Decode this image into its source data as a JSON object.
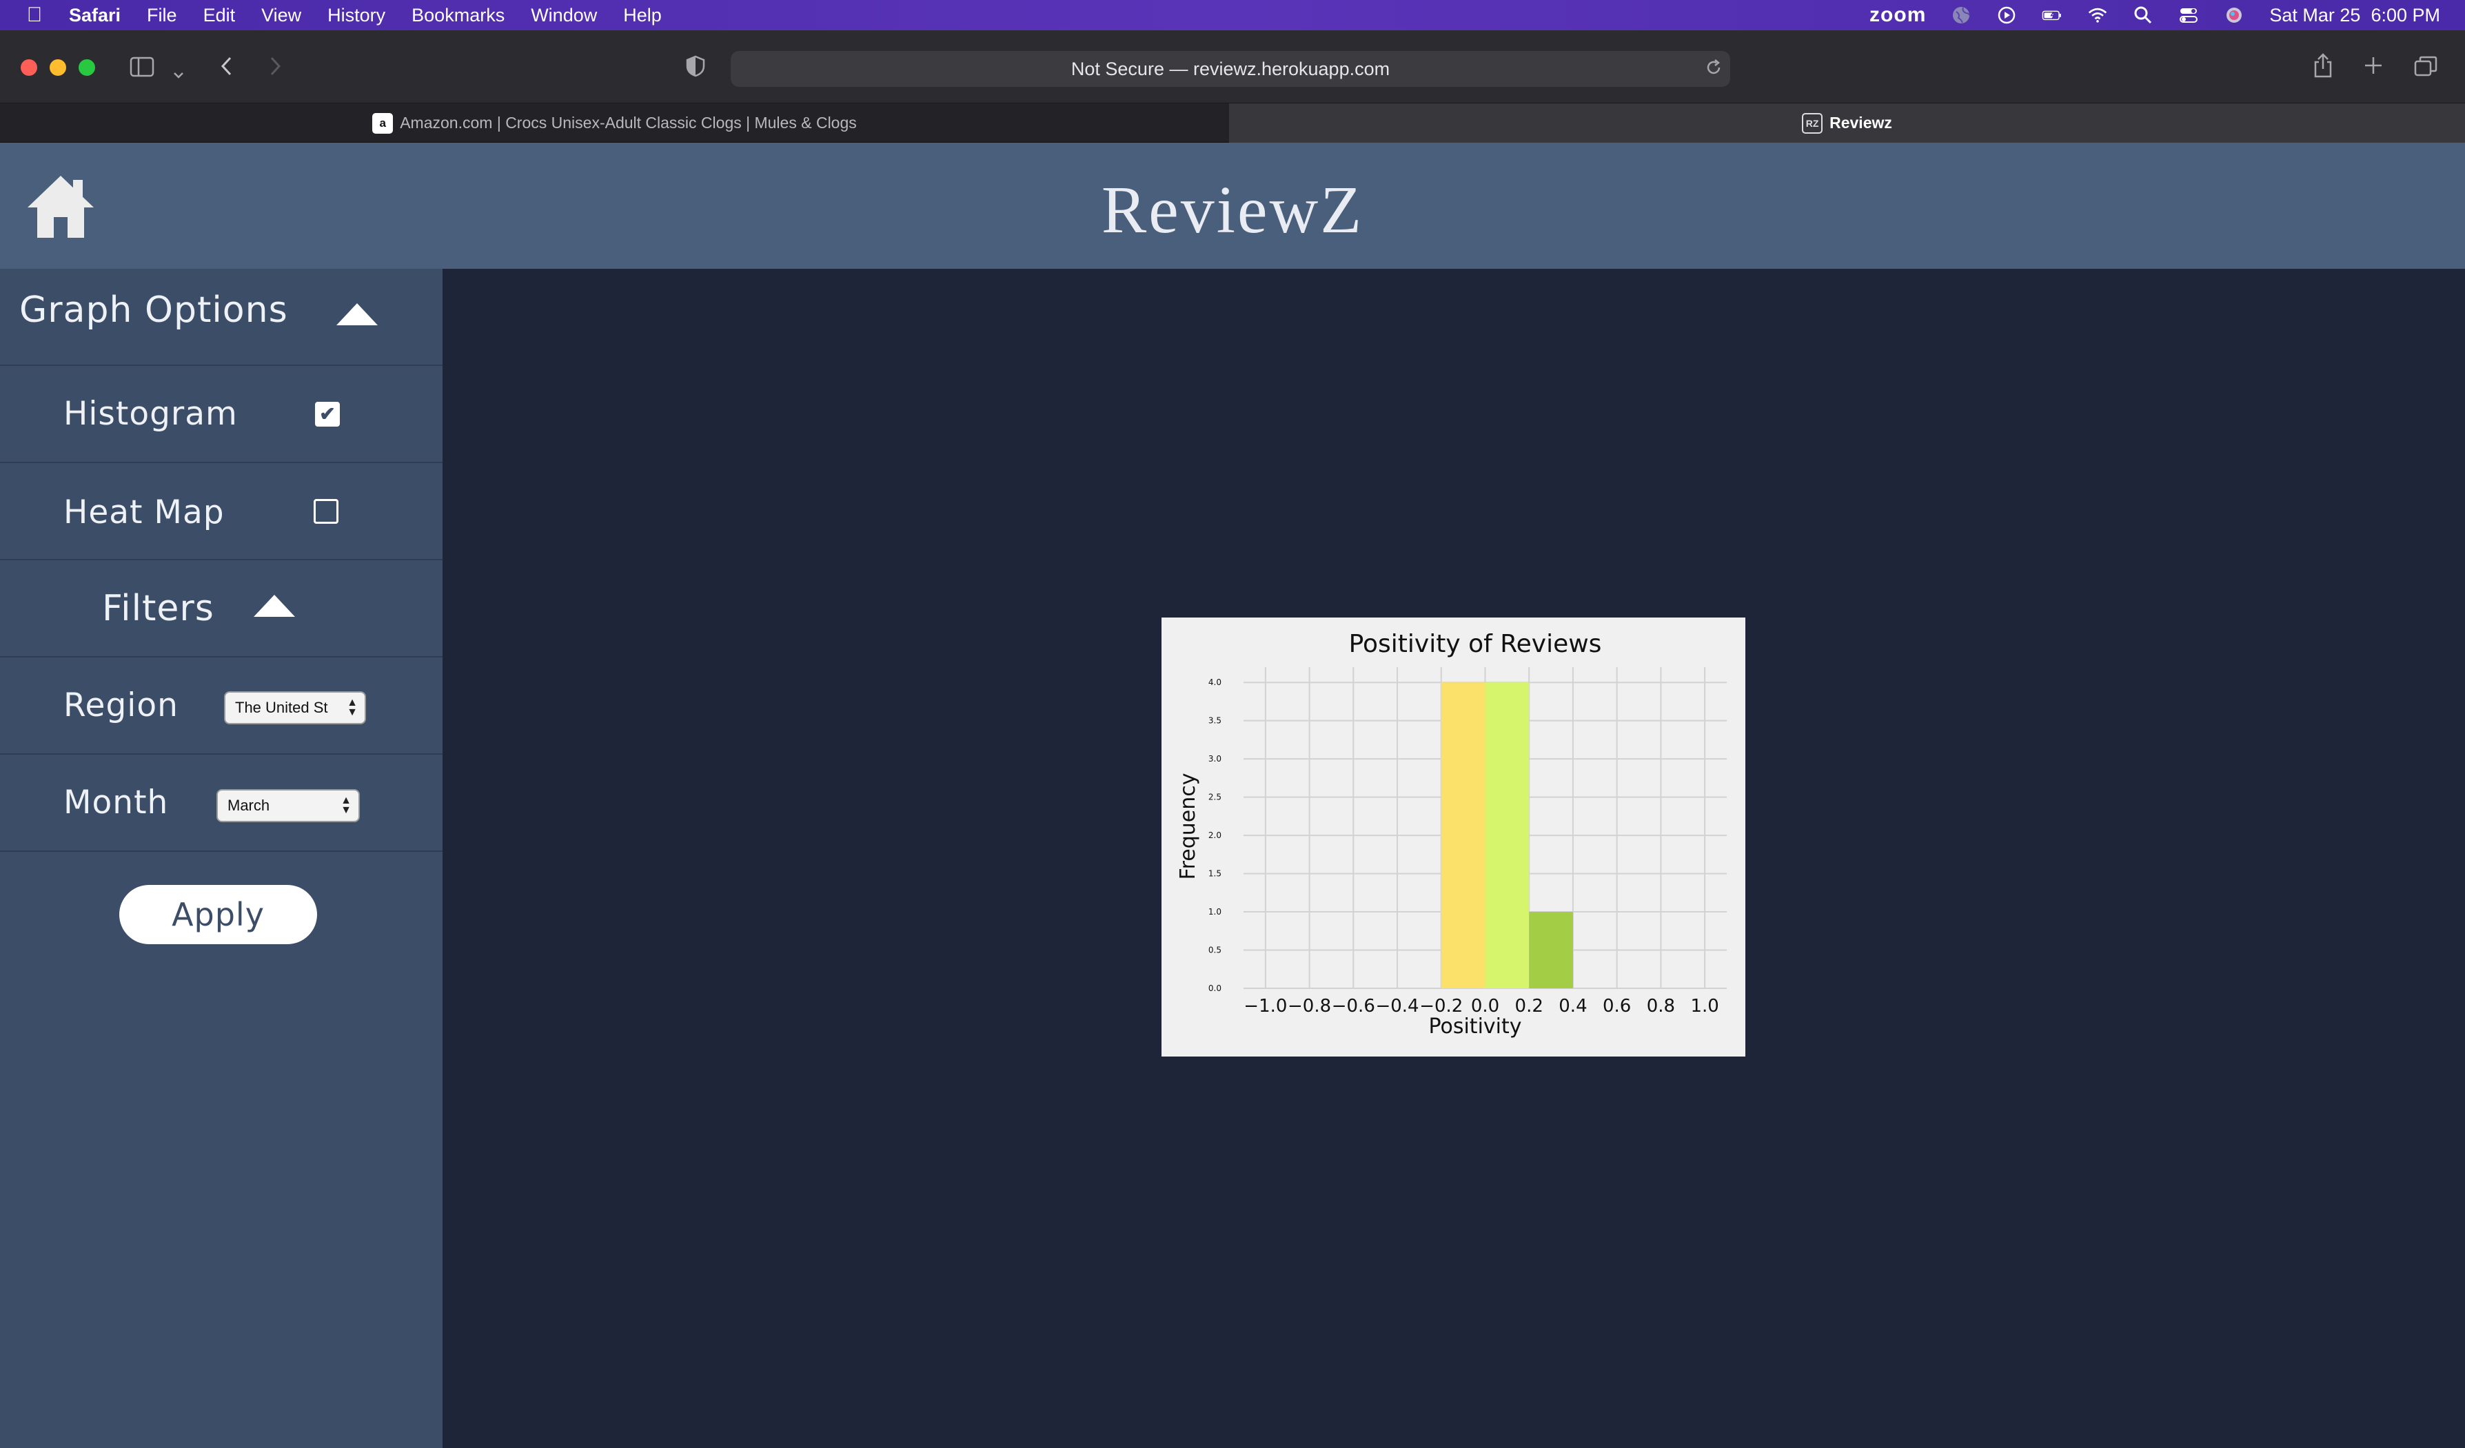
{
  "menubar": {
    "app_name": "Safari",
    "items": [
      "File",
      "Edit",
      "View",
      "History",
      "Bookmarks",
      "Window",
      "Help"
    ],
    "zoom_label": "zoom",
    "clock": "Sat Mar 25  6:00 PM"
  },
  "browser": {
    "url_text": "Not Secure — reviewz.herokuapp.com",
    "tabs": [
      {
        "label": "Amazon.com | Crocs Unisex-Adult Classic Clogs | Mules & Clogs",
        "favicon": "a",
        "active": false
      },
      {
        "label": "Reviewz",
        "favicon": "RZ",
        "active": true
      }
    ]
  },
  "app": {
    "title": "ReviewZ"
  },
  "sidebar": {
    "graph_options_label": "Graph Options",
    "histogram_label": "Histogram",
    "histogram_checked": true,
    "heatmap_label": "Heat Map",
    "heatmap_checked": false,
    "filters_label": "Filters",
    "region_label": "Region",
    "region_value": "The United St",
    "month_label": "Month",
    "month_value": "March",
    "apply_label": "Apply"
  },
  "chart_data": {
    "type": "bar",
    "title": "Positivity of Reviews",
    "xlabel": "Positivity",
    "ylabel": "Frequency",
    "xlim": [
      -1.1,
      1.1
    ],
    "ylim": [
      0,
      4.2
    ],
    "x_ticks": [
      "−1.0",
      "−0.8",
      "−0.6",
      "−0.4",
      "−0.2",
      "0.0",
      "0.2",
      "0.4",
      "0.6",
      "0.8",
      "1.0"
    ],
    "y_ticks": [
      "0.0",
      "0.5",
      "1.0",
      "1.5",
      "2.0",
      "2.5",
      "3.0",
      "3.5",
      "4.0"
    ],
    "bins": [
      {
        "x0": -0.2,
        "x1": 0.0,
        "value": 4,
        "color": "#fbe06a"
      },
      {
        "x0": 0.0,
        "x1": 0.2,
        "value": 4,
        "color": "#d6f56c"
      },
      {
        "x0": 0.2,
        "x1": 0.4,
        "value": 1,
        "color": "#a2cd44"
      }
    ],
    "grid": true
  }
}
